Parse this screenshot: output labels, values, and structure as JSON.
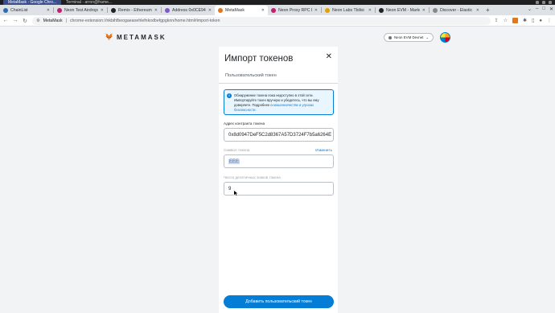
{
  "os_bar": {
    "active_app": "MetaMask - Google Chro...",
    "second_app": "Terminal - arron@frame..."
  },
  "tabs": [
    {
      "label": "ChainList",
      "color": "#2b6cb0",
      "active": false
    },
    {
      "label": "Neon Test Airdrops",
      "color": "#c0206e",
      "active": false
    },
    {
      "label": "Remix - Ethereum ID",
      "color": "#222222",
      "active": false
    },
    {
      "label": "Address 0x0CE94e...",
      "color": "#7a5cc9",
      "active": false
    },
    {
      "label": "MetaMask",
      "color": "#e2761b",
      "active": true
    },
    {
      "label": "Neon Proxy RPC En...",
      "color": "#c0206e",
      "active": false
    },
    {
      "label": "Neon Labs Tbilisi",
      "color": "#e0a200",
      "active": false
    },
    {
      "label": "Neon EVM - Marke...",
      "color": "#222222",
      "active": false
    },
    {
      "label": "Discover - Elastic",
      "color": "#888888",
      "active": false
    }
  ],
  "address_bar": {
    "extension_name": "MetaMask",
    "url": "chrome-extension://nkbihfbeogaeaoehlefnkodbefgpgknn/home.html#import-token"
  },
  "header": {
    "wordmark": "METAMASK",
    "network": "Neon EVM Devnet"
  },
  "dialog": {
    "title": "Импорт токенов",
    "close_symbol": "✕",
    "tab_label": "Пользовательский токен",
    "notice_text": "Обнаружение токена пока недоступно в этой сети. Импортируйте токен вручную и убедитесь, что вы ему доверяете. Подробнее о",
    "notice_link": "мошенничестве и угрозах безопасности.",
    "contract_label": "Адрес контракта токена",
    "contract_value": "0x8d0947DeF5C2d8367A57D3724F7b5a6264E",
    "symbol_label": "Символ токена",
    "symbol_action": "Изменить",
    "symbol_value": "ЕЕЕ",
    "decimals_label": "Число десятичных знаков токена",
    "decimals_value": "9",
    "submit_label": "Добавить пользовательский токен"
  },
  "colors": {
    "accent": "#037dd6",
    "fox": "#e2761b"
  }
}
